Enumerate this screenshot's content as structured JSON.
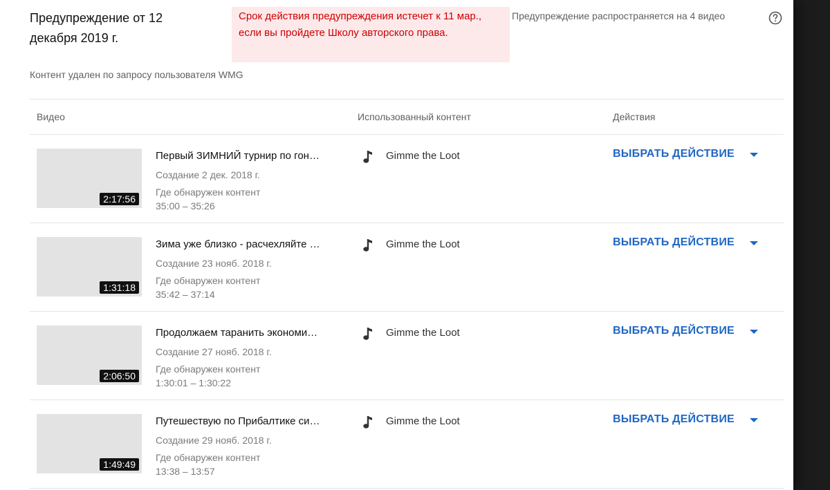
{
  "strike": {
    "title": "Предупреждение от 12 декабря 2019 г.",
    "expiry_notice": "Срок действия предупреждения истечет к 11 мар., если вы пройдете Школу авторского права.",
    "applies_to": "Предупреждение распространяется на 4 видео",
    "help_icon": "help-circle-icon",
    "removed_reason": "Контент удален по запросу пользователя WMG"
  },
  "table": {
    "headers": {
      "video": "Видео",
      "content": "Использованный контент",
      "actions": "Действия"
    },
    "rows": [
      {
        "duration": "2:17:56",
        "title": "Первый ЗИМНИЙ турнир по гон…",
        "created": "Создание 2 дек. 2018 г.",
        "found_label": "Где обнаружен контент",
        "range": "35:00 – 35:26",
        "content": "Gimme the Loot",
        "action": "ВЫБРАТЬ ДЕЙСТВИЕ"
      },
      {
        "duration": "1:31:18",
        "title": "Зима уже близко - расчехляйте …",
        "created": "Создание 23 нояб. 2018 г.",
        "found_label": "Где обнаружен контент",
        "range": "35:42 – 37:14",
        "content": "Gimme the Loot",
        "action": "ВЫБРАТЬ ДЕЙСТВИЕ"
      },
      {
        "duration": "2:06:50",
        "title": "Продолжаем таранить экономи…",
        "created": "Создание 27 нояб. 2018 г.",
        "found_label": "Где обнаружен контент",
        "range": "1:30:01 – 1:30:22",
        "content": "Gimme the Loot",
        "action": "ВЫБРАТЬ ДЕЙСТВИЕ"
      },
      {
        "duration": "1:49:49",
        "title": "Путешествую по Прибалтике си…",
        "created": "Создание 29 нояб. 2018 г.",
        "found_label": "Где обнаружен контент",
        "range": "13:38 – 13:57",
        "content": "Gimme the Loot",
        "action": "ВЫБРАТЬ ДЕЙСТВИЕ"
      }
    ]
  },
  "colors": {
    "notice_bg": "#fde8ea",
    "notice_text": "#cc0000",
    "action_blue": "#1f66c4"
  }
}
